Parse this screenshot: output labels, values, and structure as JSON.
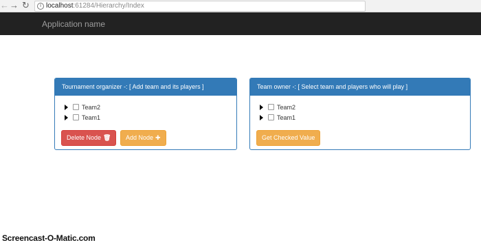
{
  "browser": {
    "url_host": "localhost",
    "url_path": ":61284/Hierarchy/Index"
  },
  "navbar": {
    "brand": "Application name"
  },
  "left_panel": {
    "title": "Tournament organizer -: [ Add team and its players ]",
    "nodes": [
      {
        "label": "Team2"
      },
      {
        "label": "Team1"
      }
    ],
    "delete_button": "Delete Node",
    "add_button": "Add Node"
  },
  "right_panel": {
    "title": "Team owner -: [ Select team and players who will play ]",
    "nodes": [
      {
        "label": "Team2"
      },
      {
        "label": "Team1"
      }
    ],
    "get_button": "Get Checked Value"
  },
  "watermark": "Screencast-O-Matic.com",
  "colors": {
    "navbar": "#222222",
    "panel_primary": "#337ab7",
    "danger": "#d9534f",
    "warning": "#f0ad4e"
  },
  "icons": {
    "back": "arrow-left-icon",
    "forward": "arrow-right-icon",
    "reload": "reload-icon",
    "info": "info-icon",
    "trash": "trash-icon",
    "plus": "plus-icon",
    "expand": "caret-right-icon"
  }
}
